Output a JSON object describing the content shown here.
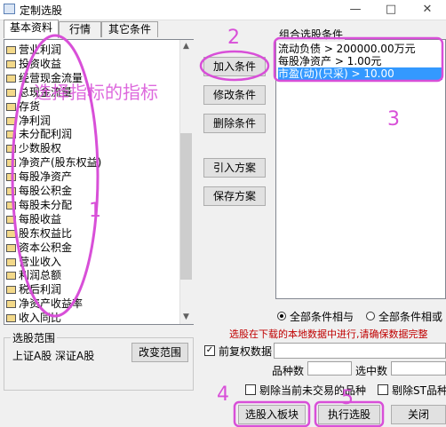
{
  "window": {
    "title": "定制选股",
    "minimize": "—",
    "maximize": "□",
    "close": "✕"
  },
  "tabs": [
    "基本资料",
    "行情",
    "其它条件"
  ],
  "indicator_list": [
    "营业利润",
    "投资收益",
    "经营现金流量",
    "总现金流量",
    "存货",
    "净利润",
    "未分配利润",
    "少数股权",
    "净资产(股东权益)",
    "每股净资产",
    "每股公积金",
    "每股未分配",
    "每股收益",
    "股东权益比",
    "资本公积金",
    "营业收入",
    "利润总额",
    "税后利润",
    "净资产收益率",
    "收入同比"
  ],
  "buttons": {
    "add": "加入条件",
    "modify": "修改条件",
    "delete": "删除条件",
    "import": "引入方案",
    "save": "保存方案",
    "change_range": "改变范围",
    "select_to_block": "选股入板块",
    "execute": "执行选股",
    "close": "关闭"
  },
  "conditions": {
    "title": "组合选股条件",
    "items": [
      "流动负债 > 200000.00万元",
      "每股净资产 > 1.00元",
      "市盈(动)(只采) > 10.00"
    ],
    "selected_index": 2
  },
  "logic": {
    "and_label": "全部条件相与",
    "or_label": "全部条件相或",
    "selected": "and"
  },
  "notice": "选股在下载的本地数据中进行,请确保数据完整",
  "range": {
    "title": "选股范围",
    "value": "上证A股 深证A股"
  },
  "options": {
    "prior_adjust_label": "前复权数据",
    "prior_adjust_checked": true,
    "count_label": "品种数",
    "selected_label": "选中数",
    "exclude_untraded_label": "剔除当前未交易的品种",
    "exclude_st_label": "剔除ST品种"
  },
  "annotations": {
    "marker_1": "1",
    "marker_2": "2",
    "marker_3": "3",
    "marker_4": "4",
    "marker_5": "5",
    "overlay_text": "选择指标的指标",
    "color": "#d84fd8"
  }
}
